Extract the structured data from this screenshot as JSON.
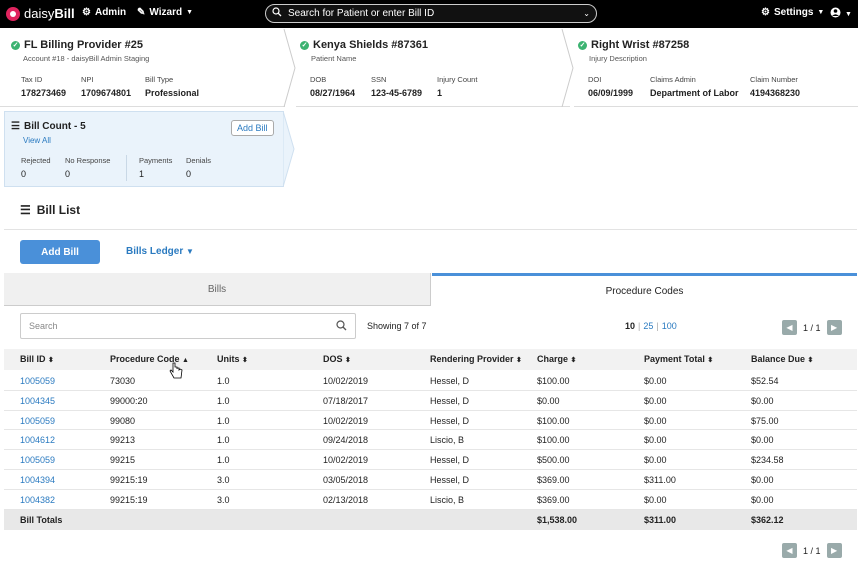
{
  "topbar": {
    "logo_plain": "daisy",
    "logo_bold": "Bill",
    "admin": "Admin",
    "wizard": "Wizard",
    "search_placeholder": "Search for Patient or enter Bill ID",
    "settings": "Settings"
  },
  "provider": {
    "title": "FL Billing Provider #25",
    "subtitle": "Account #18 - daisyBill Admin Staging",
    "fields": [
      {
        "label": "Tax ID",
        "value": "178273469"
      },
      {
        "label": "NPI",
        "value": "1709674801"
      },
      {
        "label": "Bill Type",
        "value": "Professional"
      }
    ]
  },
  "patient": {
    "title": "Kenya Shields #87361",
    "subtitle": "Patient Name",
    "fields": [
      {
        "label": "DOB",
        "value": "08/27/1964"
      },
      {
        "label": "SSN",
        "value": "123-45-6789"
      },
      {
        "label": "Injury Count",
        "value": "1"
      }
    ]
  },
  "injury": {
    "title": "Right Wrist #87258",
    "subtitle": "Injury Description",
    "fields": [
      {
        "label": "DOI",
        "value": "06/09/1999"
      },
      {
        "label": "Claims Admin",
        "value": "Department of Labor"
      },
      {
        "label": "Claim Number",
        "value": "4194368230"
      }
    ]
  },
  "bill_count": {
    "title": "Bill Count - 5",
    "view_all": "View All",
    "add_bill": "Add Bill",
    "stats": [
      {
        "label": "Rejected",
        "value": "0"
      },
      {
        "label": "No Response",
        "value": "0"
      },
      {
        "label": "Payments",
        "value": "1"
      },
      {
        "label": "Denials",
        "value": "0"
      }
    ]
  },
  "bill_list": {
    "title": "Bill List",
    "add_bill": "Add Bill",
    "ledger": "Bills Ledger",
    "tabs": [
      "Bills",
      "Procedure Codes"
    ],
    "search_placeholder": "Search",
    "showing": "Showing 7 of 7",
    "page_sizes": [
      "10",
      "25",
      "100"
    ],
    "page_indicator": "1 / 1",
    "columns": [
      "Bill ID",
      "Procedure Code",
      "Units",
      "DOS",
      "Rendering Provider",
      "Charge",
      "Payment Total",
      "Balance Due"
    ],
    "rows": [
      [
        "1005059",
        "73030",
        "1.0",
        "10/02/2019",
        "Hessel, D",
        "$100.00",
        "$0.00",
        "$52.54"
      ],
      [
        "1004345",
        "99000:20",
        "1.0",
        "07/18/2017",
        "Hessel, D",
        "$0.00",
        "$0.00",
        "$0.00"
      ],
      [
        "1005059",
        "99080",
        "1.0",
        "10/02/2019",
        "Hessel, D",
        "$100.00",
        "$0.00",
        "$75.00"
      ],
      [
        "1004612",
        "99213",
        "1.0",
        "09/24/2018",
        "Liscio, B",
        "$100.00",
        "$0.00",
        "$0.00"
      ],
      [
        "1005059",
        "99215",
        "1.0",
        "10/02/2019",
        "Hessel, D",
        "$500.00",
        "$0.00",
        "$234.58"
      ],
      [
        "1004394",
        "99215:19",
        "3.0",
        "03/05/2018",
        "Hessel, D",
        "$369.00",
        "$311.00",
        "$0.00"
      ],
      [
        "1004382",
        "99215:19",
        "3.0",
        "02/13/2018",
        "Liscio, B",
        "$369.00",
        "$0.00",
        "$0.00"
      ]
    ],
    "totals": {
      "label": "Bill Totals",
      "charge": "$1,538.00",
      "payment": "$311.00",
      "balance": "$362.12"
    }
  },
  "colors": {
    "accent": "#4a90d9",
    "link": "#2a7ac0",
    "check": "#3cb371",
    "brand": "#e0245e"
  }
}
